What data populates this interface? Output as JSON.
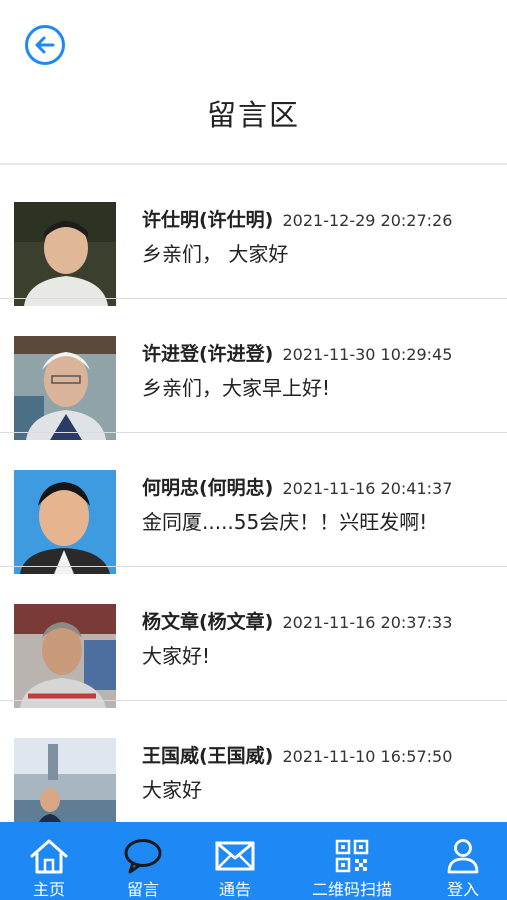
{
  "header": {
    "back_icon": "arrow-left-circle-icon",
    "title": "留言区"
  },
  "messages": [
    {
      "name": "许仕明(许仕明)",
      "time": "2021-12-29 20:27:26",
      "text": "乡亲们， 大家好"
    },
    {
      "name": "许进登(许进登)",
      "time": "2021-11-30 10:29:45",
      "text": "乡亲们，大家早上好!"
    },
    {
      "name": "何明忠(何明忠)",
      "time": "2021-11-16 20:41:37",
      "text": "金同厦.....55会庆！！兴旺发啊!"
    },
    {
      "name": "杨文章(杨文章)",
      "time": "2021-11-16 20:37:33",
      "text": "大家好!"
    },
    {
      "name": "王国威(王国威)",
      "time": "2021-11-10 16:57:50",
      "text": "大家好"
    }
  ],
  "nav": {
    "items": [
      {
        "label": "主页",
        "icon": "home-icon"
      },
      {
        "label": "留言",
        "icon": "chat-bubble-icon"
      },
      {
        "label": "通告",
        "icon": "envelope-icon"
      },
      {
        "label": "二维码扫描",
        "icon": "qr-code-icon"
      },
      {
        "label": "登入",
        "icon": "user-icon"
      }
    ],
    "active_index": 1
  },
  "colors": {
    "accent": "#1e88f5",
    "nav_background": "#1e88f5",
    "divider": "#dcdcdc"
  }
}
